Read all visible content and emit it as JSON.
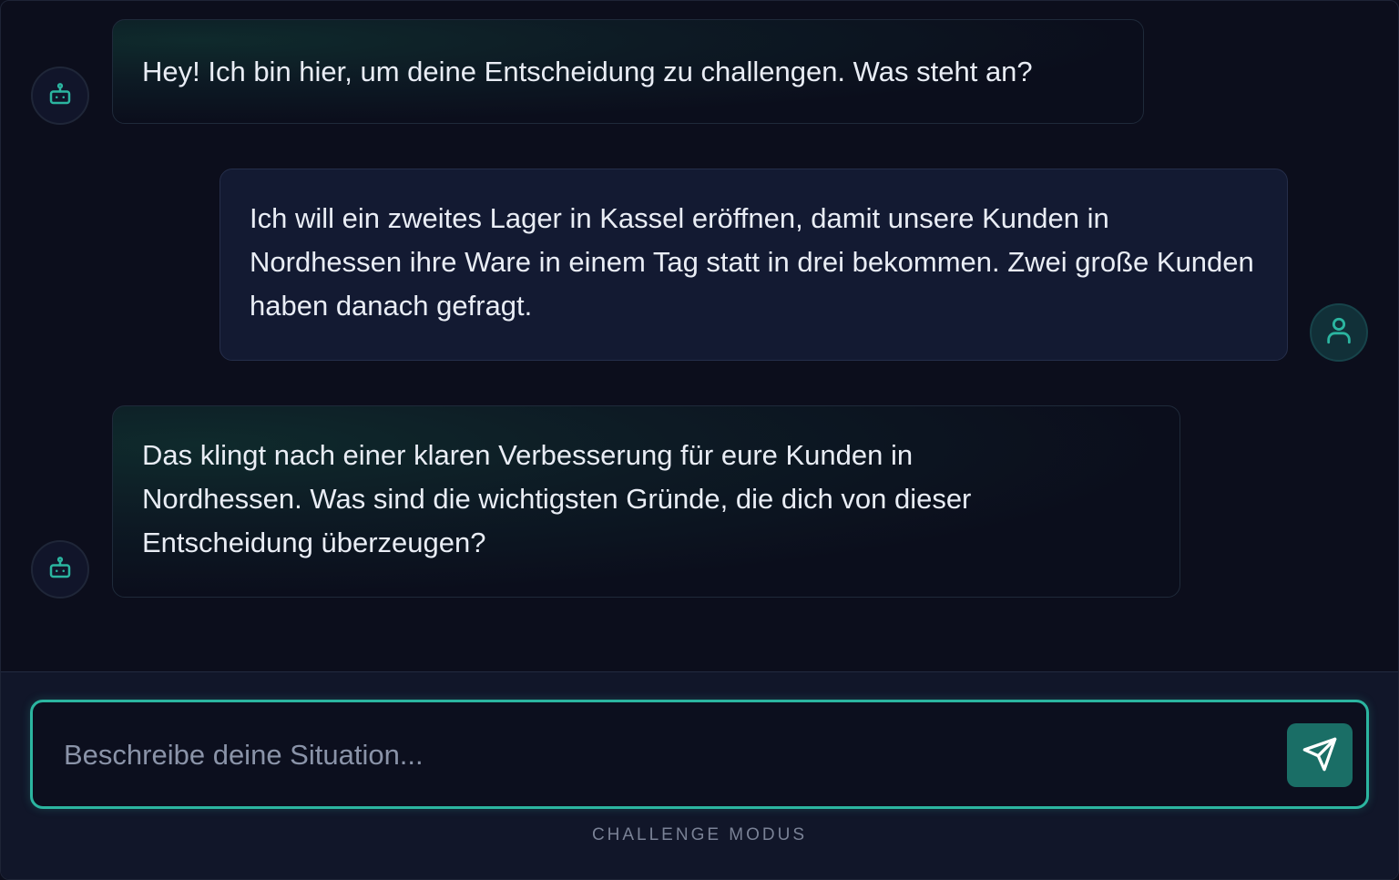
{
  "messages": [
    {
      "role": "bot",
      "text": "Hey! Ich bin hier, um deine Entscheidung zu challengen. Was steht an?"
    },
    {
      "role": "user",
      "text": "Ich will ein zweites Lager in Kassel eröffnen, damit unsere Kunden in Nordhessen ihre Ware in einem Tag statt in drei bekommen. Zwei große Kunden haben danach gefragt."
    },
    {
      "role": "bot",
      "text": "Das klingt nach einer klaren Verbesserung für eure Kunden in Nordhessen. Was sind die wichtigsten Gründe, die dich von dieser Entscheidung überzeugen?"
    }
  ],
  "composer": {
    "placeholder": "Beschreibe deine Situation...",
    "value": "",
    "send_icon": "send-icon"
  },
  "footer": {
    "mode_label": "CHALLENGE MODUS"
  },
  "icons": {
    "bot": "robot-icon",
    "user": "user-icon"
  },
  "colors": {
    "accent": "#2bb5a0",
    "send_button": "#1a6e66",
    "background": "#0c0e1c",
    "user_bubble": "#131a32"
  }
}
